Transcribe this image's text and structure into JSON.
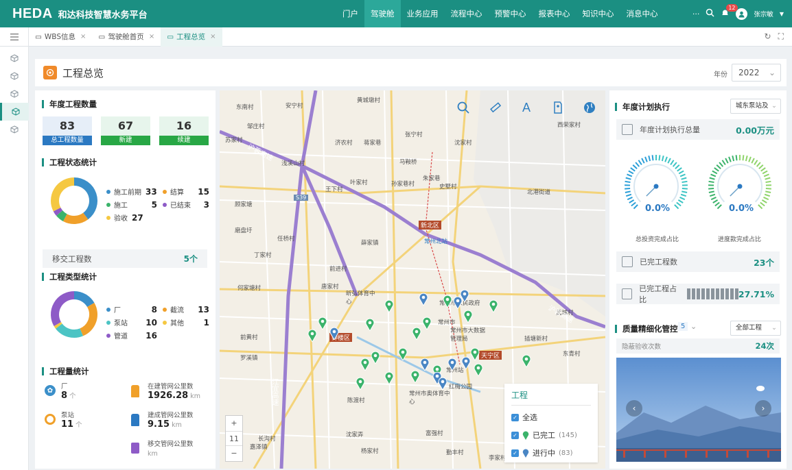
{
  "header": {
    "logo": "HEDA",
    "app_title": "和达科技智慧水务平台",
    "nav": [
      "门户",
      "驾驶舱",
      "业务应用",
      "流程中心",
      "预警中心",
      "报表中心",
      "知识中心",
      "消息中心"
    ],
    "active_nav": 1,
    "more_label": "···",
    "notification_count": "12",
    "user_name": "张宗敏"
  },
  "tabs": [
    {
      "label": "WBS信息",
      "active": false
    },
    {
      "label": "驾驶舱首页",
      "active": false
    },
    {
      "label": "工程总览",
      "active": true
    }
  ],
  "page": {
    "title": "工程总览",
    "year_label": "年份",
    "year_value": "2022"
  },
  "annual_projects": {
    "title": "年度工程数量",
    "items": [
      {
        "value": "83",
        "label": "总工程数量",
        "color": "#2b79c2"
      },
      {
        "value": "67",
        "label": "新建",
        "color": "#28a745"
      },
      {
        "value": "16",
        "label": "续建",
        "color": "#28a745"
      }
    ]
  },
  "status_stats": {
    "title": "工程状态统计",
    "items": [
      {
        "label": "施工前期",
        "value": "33",
        "color": "#3b8fc9"
      },
      {
        "label": "结算",
        "value": "15",
        "color": "#f0a02a"
      },
      {
        "label": "施工",
        "value": "5",
        "color": "#3bb36b"
      },
      {
        "label": "已结束",
        "value": "3",
        "color": "#8e5bc7"
      },
      {
        "label": "验收",
        "value": "27",
        "color": "#f5c842"
      }
    ],
    "transfer_label": "移交工程数",
    "transfer_value": "5个"
  },
  "type_stats": {
    "title": "工程类型统计",
    "items": [
      {
        "label": "厂",
        "value": "8",
        "color": "#3b8fc9"
      },
      {
        "label": "截流",
        "value": "13",
        "color": "#f0a02a"
      },
      {
        "label": "泵站",
        "value": "10",
        "color": "#4cc4c4"
      },
      {
        "label": "其他",
        "value": "1",
        "color": "#f5c842"
      },
      {
        "label": "管道",
        "value": "16",
        "color": "#8e5bc7"
      }
    ]
  },
  "quantity_stats": {
    "title": "工程量统计",
    "factory_label": "厂",
    "factory_value": "8",
    "factory_unit": "个",
    "pump_label": "泵站",
    "pump_value": "11",
    "pump_unit": "个",
    "pipe_building_label": "在建管网公里数",
    "pipe_building_value": "1926.28",
    "pipe_built_label": "建成管网公里数",
    "pipe_built_value": "9.15",
    "pipe_transfer_label": "移交管网公里数",
    "pipe_transfer_value": "",
    "km_unit": "km"
  },
  "map": {
    "labels": [
      {
        "text": "东南村"
      },
      {
        "text": "安宁村"
      },
      {
        "text": "黄城墩村"
      },
      {
        "text": "邹庄村"
      },
      {
        "text": "苏家村"
      },
      {
        "text": "济农村"
      },
      {
        "text": "蒋家巷"
      },
      {
        "text": "张宁村"
      },
      {
        "text": "沈家村"
      },
      {
        "text": "西荣家村"
      },
      {
        "text": "马鞍桥"
      },
      {
        "text": "浅溪山村"
      },
      {
        "text": "孙家巷村"
      },
      {
        "text": "朱家巷"
      },
      {
        "text": "史墅村"
      },
      {
        "text": "叶家村"
      },
      {
        "text": "王下村"
      },
      {
        "text": "顾家塘"
      },
      {
        "text": "北港街道"
      },
      {
        "text": "磨盘圩"
      },
      {
        "text": "任桥村"
      },
      {
        "text": "薛家镇"
      },
      {
        "text": "丁家村"
      },
      {
        "text": "前进村"
      },
      {
        "text": "何家塘村"
      },
      {
        "text": "唐家村"
      },
      {
        "text": "昕弘体育中心"
      },
      {
        "text": "常州北站"
      },
      {
        "text": "常州市"
      },
      {
        "text": "常州市人民政府"
      },
      {
        "text": "常州市大数据管理局"
      },
      {
        "text": "插塘新村"
      },
      {
        "text": "武城村"
      },
      {
        "text": "东青村"
      },
      {
        "text": "前黄村"
      },
      {
        "text": "罗溪镇"
      },
      {
        "text": "常州站"
      },
      {
        "text": "红梅公园"
      },
      {
        "text": "常州市奥体育中心"
      },
      {
        "text": "陈渡村"
      },
      {
        "text": "沈家弄"
      },
      {
        "text": "富强村"
      },
      {
        "text": "长沟村"
      },
      {
        "text": "嘉泽镇"
      },
      {
        "text": "杨家村"
      },
      {
        "text": "勤丰村"
      },
      {
        "text": "李家村"
      }
    ],
    "districts": [
      "新北区",
      "钟楼区",
      "天宁区"
    ],
    "highway_labels": [
      "沪蓉高速",
      "沪蓉高速",
      "江宜高速"
    ],
    "route_badge": "S39",
    "zoom_plus": "+",
    "zoom_level": "11",
    "zoom_minus": "−",
    "legend_title": "工程",
    "legend_all": "全选",
    "legend_done": "已完工",
    "legend_done_count": "(145)",
    "legend_doing": "进行中",
    "legend_doing_count": "(83)",
    "tool_icons": [
      "search-icon",
      "ruler-icon",
      "text-icon",
      "tag-icon",
      "globe-icon"
    ]
  },
  "annual_plan": {
    "title": "年度计划执行",
    "select_value": "城东泵站及",
    "total_label": "年度计划执行总量",
    "total_value": "0.00万元",
    "gauge1_value": "0.0%",
    "gauge1_caption": "总投资完成占比",
    "gauge1_level": 0.0,
    "gauge2_value": "0.0%",
    "gauge2_caption": "进度款完成占比",
    "gauge2_level": 0.0,
    "done_label": "已完工程数",
    "done_value": "23个",
    "ratio_label": "已完工程占比",
    "ratio_value": "27.71%"
  },
  "quality": {
    "title": "质量精细化管控",
    "count": "5",
    "select_value": "全部工程",
    "hidden_label": "隐蔽验收次数",
    "hidden_value": "24次"
  },
  "colors": {
    "brand": "#1b8f82",
    "blue": "#2b79c2",
    "green": "#28a745"
  }
}
